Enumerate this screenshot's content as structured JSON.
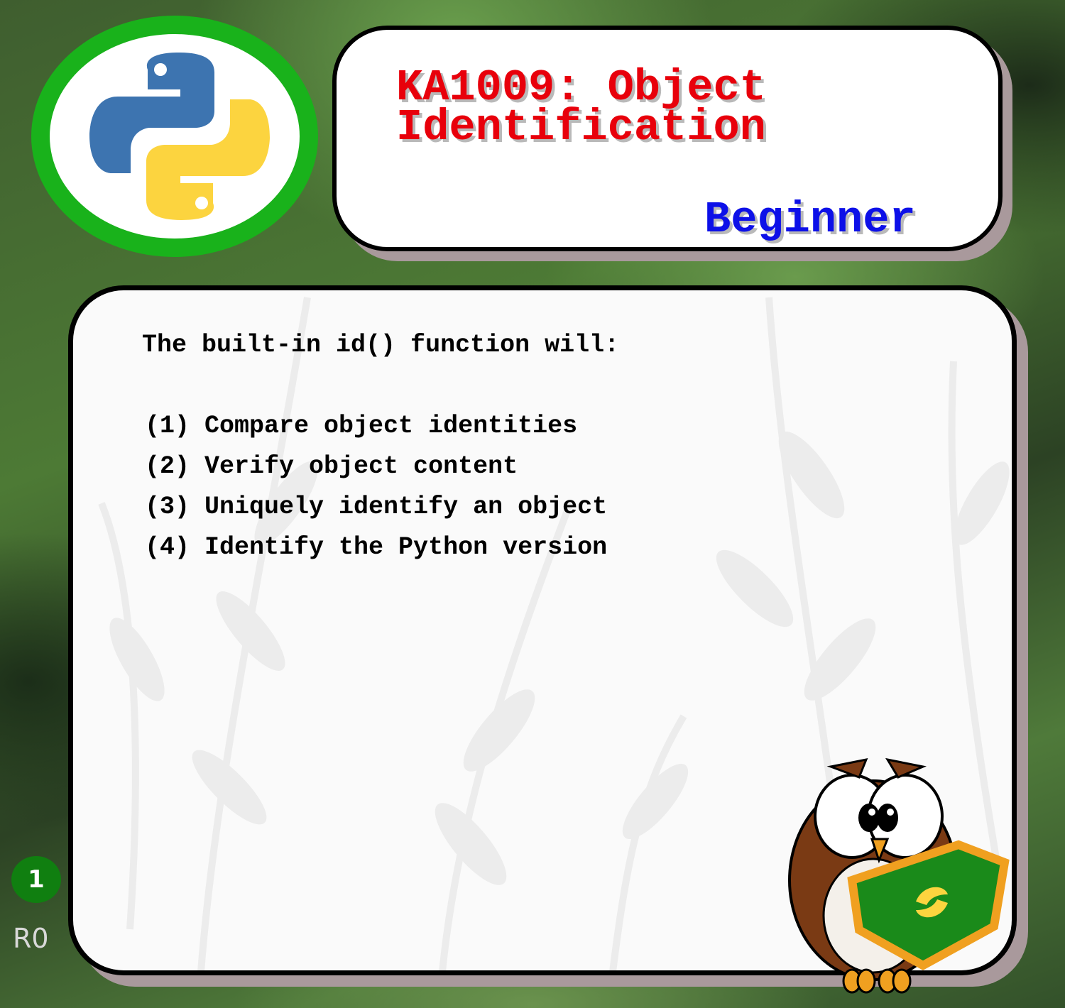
{
  "header": {
    "title_line1": "KA1009: Object",
    "title_line2": "Identification",
    "level": "Beginner"
  },
  "question": {
    "prompt": "The built-in id() function will:",
    "options": [
      "(1) Compare object identities",
      "(2) Verify object content",
      "(3) Uniquely identify an object",
      "(4) Identify the Python version"
    ]
  },
  "footer": {
    "badge_number": "1",
    "revision": "R0"
  },
  "colors": {
    "title": "#e8000b",
    "level": "#0d10e8",
    "logo_ring": "#19b21b",
    "badge": "#107f10",
    "python_blue": "#3d74b0",
    "python_yellow": "#fcd43f"
  },
  "icons": [
    "python-logo-icon",
    "owl-mascot-icon",
    "leaf-pattern"
  ]
}
